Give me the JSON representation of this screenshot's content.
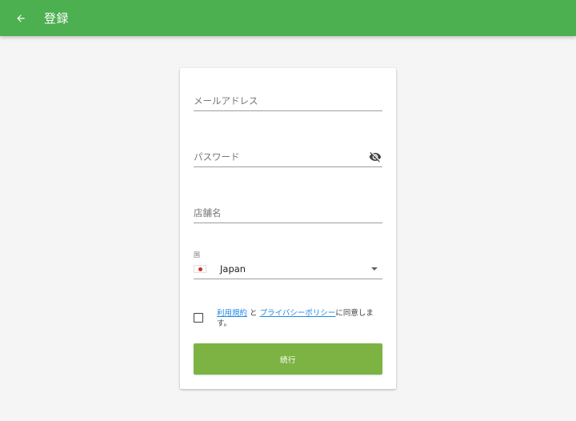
{
  "appbar": {
    "title": "登録",
    "back_icon": "arrow-left-icon",
    "color": "#4caf50"
  },
  "form": {
    "email": {
      "placeholder": "メールアドレス",
      "value": ""
    },
    "password": {
      "placeholder": "パスワード",
      "value": "",
      "toggle_icon": "eye-off-icon"
    },
    "shop_name": {
      "placeholder": "店舗名",
      "value": ""
    },
    "country": {
      "label": "国",
      "value": "Japan",
      "flag_icon": "japan-flag-icon"
    },
    "terms": {
      "checked": false,
      "link_terms": "利用規約",
      "connector": " と ",
      "link_privacy": "プライバシーポリシー",
      "suffix": "に同意します。"
    },
    "continue_label": "続行",
    "button_color": "#7cb342",
    "link_color": "#1e88e5"
  }
}
